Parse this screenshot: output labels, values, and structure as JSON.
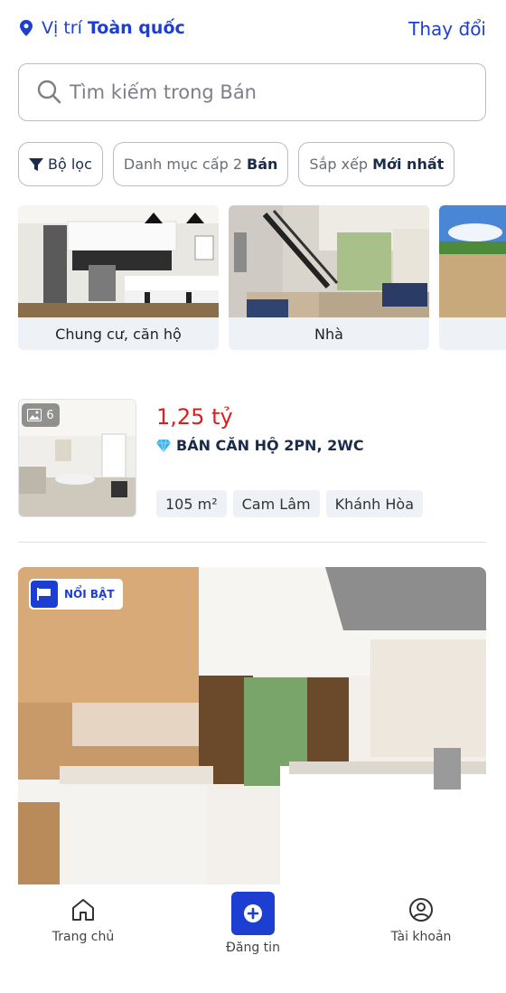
{
  "header": {
    "location_prefix": "Vị trí",
    "location_value": "Toàn quốc",
    "change_label": "Thay đổi"
  },
  "search": {
    "placeholder": "Tìm kiếm trong Bán"
  },
  "filters": {
    "filter_label": "Bộ lọc",
    "category_prefix": "Danh mục cấp 2",
    "category_value": "Bán",
    "sort_prefix": "Sắp xếp",
    "sort_value": "Mới nhất"
  },
  "categories": [
    {
      "label": "Chung cư, căn hộ"
    },
    {
      "label": "Nhà"
    },
    {
      "label": ""
    }
  ],
  "listing": {
    "photo_count": "6",
    "price": "1,25 tỷ",
    "title": "BÁN CĂN HỘ 2PN, 2WC",
    "tags": [
      "105 m²",
      "Cam Lâm",
      "Khánh Hòa"
    ]
  },
  "featured": {
    "badge": "NỔI BẬT"
  },
  "bottom_nav": {
    "home": "Trang chủ",
    "post": "Đăng tin",
    "account": "Tài khoản"
  },
  "colors": {
    "accent": "#1c3fd1",
    "price": "#d91f1f"
  }
}
